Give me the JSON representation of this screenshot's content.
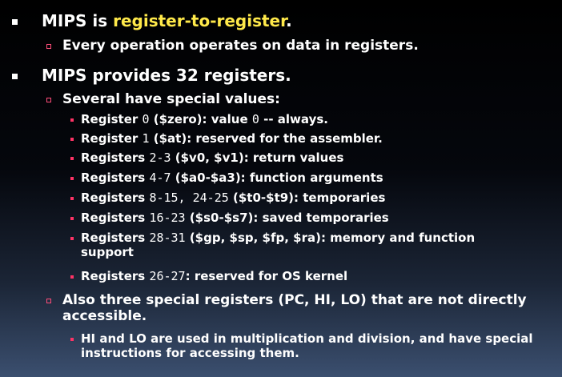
{
  "bullets": {
    "b1_prefix": "MIPS is ",
    "b1_highlight": "register-to-register",
    "b1_suffix": ".",
    "b1_sub1": "Every operation operates on data in registers.",
    "b2": "MIPS provides 32 registers.",
    "b2_sub1": "Several have special values:",
    "reg0_a": "Register ",
    "reg0_num": "0",
    "reg0_b": " ($zero): value ",
    "reg0_val": "0",
    "reg0_c": " -- always.",
    "reg1_a": "Register ",
    "reg1_num": "1",
    "reg1_b": " ($at): reserved for the assembler.",
    "reg23_a": "Registers ",
    "reg23_num": "2-3",
    "reg23_b": " ($v0, $v1): return values",
    "reg47_a": "Registers ",
    "reg47_num": "4-7",
    "reg47_b": " ($a0-$a3): function arguments",
    "regt_a": "Registers ",
    "regt_num": "8-15, 24-25",
    "regt_b": " ($t0-$t9): temporaries",
    "regs_a": "Registers ",
    "regs_num": "16-23",
    "regs_b": " ($s0-$s7): saved temporaries",
    "regsp_a": "Registers ",
    "regsp_num": "28-31",
    "regsp_b": " ($gp, $sp, $fp, $ra): memory and function",
    "regsp_c": "support",
    "regk_a": "Registers ",
    "regk_num": "26-27",
    "regk_b": ": reserved for OS kernel",
    "b2_sub2_l1": "Also three special registers (PC, HI, LO) that are not directly",
    "b2_sub2_l2": "accessible.",
    "b2_sub2_sub1_l1": "HI and LO are used in multiplication and division, and have special",
    "b2_sub2_sub1_l2": "instructions for accessing them."
  }
}
